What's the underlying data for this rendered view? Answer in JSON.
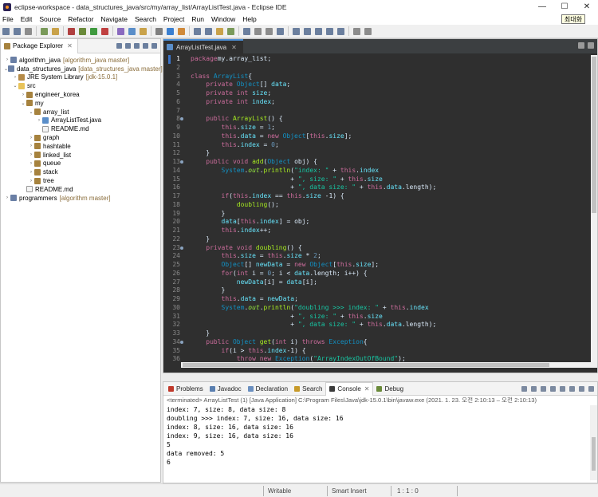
{
  "window": {
    "title": "eclipse-workspace - data_structures_java/src/my/array_list/ArrayListTest.java - Eclipse IDE",
    "minimize": "—",
    "maximize": "☐",
    "close": "✕",
    "tooltip": "최대화"
  },
  "menu": [
    "File",
    "Edit",
    "Source",
    "Refactor",
    "Navigate",
    "Search",
    "Project",
    "Run",
    "Window",
    "Help"
  ],
  "package_explorer": {
    "title": "Package Explorer",
    "items": [
      {
        "indent": 0,
        "twisty": "›",
        "icon": "proj",
        "label": "algorithm_java",
        "deco": "[algorithm_java master]"
      },
      {
        "indent": 0,
        "twisty": "⌄",
        "icon": "proj",
        "label": "data_structures_java",
        "deco": "[data_structures_java master]"
      },
      {
        "indent": 1,
        "twisty": "›",
        "icon": "lib",
        "label": "JRE System Library",
        "deco": "[jdk-15.0.1]"
      },
      {
        "indent": 1,
        "twisty": "⌄",
        "icon": "fold",
        "label": "src",
        "deco": ""
      },
      {
        "indent": 2,
        "twisty": "›",
        "icon": "pkg",
        "label": "engineer_korea",
        "deco": ""
      },
      {
        "indent": 2,
        "twisty": "⌄",
        "icon": "pkg",
        "label": "my",
        "deco": ""
      },
      {
        "indent": 3,
        "twisty": "⌄",
        "icon": "pkg",
        "label": "array_list",
        "deco": ""
      },
      {
        "indent": 4,
        "twisty": "›",
        "icon": "jfile",
        "label": "ArrayListTest.java",
        "deco": ""
      },
      {
        "indent": 4,
        "twisty": "",
        "icon": "file",
        "label": "README.md",
        "deco": ""
      },
      {
        "indent": 3,
        "twisty": "›",
        "icon": "pkg",
        "label": "graph",
        "deco": ""
      },
      {
        "indent": 3,
        "twisty": "›",
        "icon": "pkg",
        "label": "hashtable",
        "deco": ""
      },
      {
        "indent": 3,
        "twisty": "›",
        "icon": "pkg",
        "label": "linked_list",
        "deco": ""
      },
      {
        "indent": 3,
        "twisty": "›",
        "icon": "pkg",
        "label": "queue",
        "deco": ""
      },
      {
        "indent": 3,
        "twisty": "›",
        "icon": "pkg",
        "label": "stack",
        "deco": ""
      },
      {
        "indent": 3,
        "twisty": "›",
        "icon": "pkg",
        "label": "tree",
        "deco": ""
      },
      {
        "indent": 2,
        "twisty": "",
        "icon": "file",
        "label": "README.md",
        "deco": ""
      },
      {
        "indent": 0,
        "twisty": "›",
        "icon": "proj",
        "label": "programmers",
        "deco": "[algorithm master]"
      }
    ]
  },
  "editor": {
    "tab_label": "ArrayListTest.java",
    "tab_close": "✕",
    "lines": [
      {
        "n": "1",
        "mark": false,
        "cur": true,
        "t": [
          [
            "kw",
            "package"
          ],
          [
            "",
            "my.array_list;"
          ]
        ]
      },
      {
        "n": "2",
        "mark": false,
        "t": []
      },
      {
        "n": "3",
        "mark": false,
        "t": [
          [
            "kw",
            "class "
          ],
          [
            "cls",
            "ArrayList"
          ],
          [
            "",
            "{"
          ]
        ]
      },
      {
        "n": "4",
        "mark": false,
        "t": [
          [
            "",
            "    "
          ],
          [
            "kw",
            "private "
          ],
          [
            "ty",
            "Object"
          ],
          [
            "",
            "[] "
          ],
          [
            "fld",
            "data"
          ],
          [
            "",
            ";"
          ]
        ]
      },
      {
        "n": "5",
        "mark": false,
        "t": [
          [
            "",
            "    "
          ],
          [
            "kw",
            "private int "
          ],
          [
            "fld",
            "size"
          ],
          [
            "",
            ";"
          ]
        ]
      },
      {
        "n": "6",
        "mark": false,
        "t": [
          [
            "",
            "    "
          ],
          [
            "kw",
            "private int "
          ],
          [
            "fld",
            "index"
          ],
          [
            "",
            ";"
          ]
        ]
      },
      {
        "n": "7",
        "mark": false,
        "t": []
      },
      {
        "n": "8",
        "mark": true,
        "t": [
          [
            "",
            "    "
          ],
          [
            "kw",
            "public "
          ],
          [
            "mth",
            "ArrayList"
          ],
          [
            "",
            "() {"
          ]
        ]
      },
      {
        "n": "9",
        "mark": false,
        "t": [
          [
            "",
            "        "
          ],
          [
            "kw",
            "this"
          ],
          [
            "",
            "."
          ],
          [
            "fld",
            "size"
          ],
          [
            "",
            " = "
          ],
          [
            "num",
            "1"
          ],
          [
            "",
            ";"
          ]
        ]
      },
      {
        "n": "10",
        "mark": false,
        "t": [
          [
            "",
            "        "
          ],
          [
            "kw",
            "this"
          ],
          [
            "",
            "."
          ],
          [
            "fld",
            "data"
          ],
          [
            "",
            " = "
          ],
          [
            "kw",
            "new "
          ],
          [
            "ty",
            "Object"
          ],
          [
            "",
            "["
          ],
          [
            "kw",
            "this"
          ],
          [
            "",
            "."
          ],
          [
            "fld",
            "size"
          ],
          [
            "",
            "];"
          ]
        ]
      },
      {
        "n": "11",
        "mark": false,
        "t": [
          [
            "",
            "        "
          ],
          [
            "kw",
            "this"
          ],
          [
            "",
            "."
          ],
          [
            "fld",
            "index"
          ],
          [
            "",
            " = "
          ],
          [
            "num",
            "0"
          ],
          [
            "",
            ";"
          ]
        ]
      },
      {
        "n": "12",
        "mark": false,
        "t": [
          [
            "",
            "    }"
          ]
        ]
      },
      {
        "n": "13",
        "mark": true,
        "t": [
          [
            "",
            "    "
          ],
          [
            "kw",
            "public void "
          ],
          [
            "mth",
            "add"
          ],
          [
            "",
            "("
          ],
          [
            "ty",
            "Object"
          ],
          [
            "",
            " obj) {"
          ]
        ]
      },
      {
        "n": "14",
        "mark": false,
        "t": [
          [
            "",
            "        "
          ],
          [
            "ty",
            "System"
          ],
          [
            "",
            "."
          ],
          [
            "st",
            "out"
          ],
          [
            "",
            "."
          ],
          [
            "mth",
            "println"
          ],
          [
            "",
            "("
          ],
          [
            "str",
            "\"index: \""
          ],
          [
            "",
            " + "
          ],
          [
            "kw",
            "this"
          ],
          [
            "",
            "."
          ],
          [
            "fld",
            "index"
          ]
        ]
      },
      {
        "n": "15",
        "mark": false,
        "t": [
          [
            "",
            "                          + "
          ],
          [
            "str",
            "\", size: \""
          ],
          [
            "",
            " + "
          ],
          [
            "kw",
            "this"
          ],
          [
            "",
            "."
          ],
          [
            "fld",
            "size"
          ]
        ]
      },
      {
        "n": "16",
        "mark": false,
        "t": [
          [
            "",
            "                          + "
          ],
          [
            "str",
            "\", data size: \""
          ],
          [
            "",
            " + "
          ],
          [
            "kw",
            "this"
          ],
          [
            "",
            "."
          ],
          [
            "fld",
            "data"
          ],
          [
            "",
            ".length);"
          ]
        ]
      },
      {
        "n": "17",
        "mark": false,
        "t": [
          [
            "",
            "        "
          ],
          [
            "kw",
            "if"
          ],
          [
            "",
            "("
          ],
          [
            "kw",
            "this"
          ],
          [
            "",
            "."
          ],
          [
            "fld",
            "index"
          ],
          [
            "",
            " == "
          ],
          [
            "kw",
            "this"
          ],
          [
            "",
            "."
          ],
          [
            "fld",
            "size"
          ],
          [
            "",
            " -1) {"
          ]
        ]
      },
      {
        "n": "18",
        "mark": false,
        "t": [
          [
            "",
            "            "
          ],
          [
            "mth",
            "doubling"
          ],
          [
            "",
            "();"
          ]
        ]
      },
      {
        "n": "19",
        "mark": false,
        "t": [
          [
            "",
            "        }"
          ]
        ]
      },
      {
        "n": "20",
        "mark": false,
        "t": [
          [
            "",
            "        "
          ],
          [
            "fld",
            "data"
          ],
          [
            "",
            "["
          ],
          [
            "kw",
            "this"
          ],
          [
            "",
            "."
          ],
          [
            "fld",
            "index"
          ],
          [
            "",
            "] = obj;"
          ]
        ]
      },
      {
        "n": "21",
        "mark": false,
        "t": [
          [
            "",
            "        "
          ],
          [
            "kw",
            "this"
          ],
          [
            "",
            "."
          ],
          [
            "fld",
            "index"
          ],
          [
            "",
            "++;"
          ]
        ]
      },
      {
        "n": "22",
        "mark": false,
        "t": [
          [
            "",
            "    }"
          ]
        ]
      },
      {
        "n": "23",
        "mark": true,
        "t": [
          [
            "",
            "    "
          ],
          [
            "kw",
            "private void "
          ],
          [
            "mth",
            "doubling"
          ],
          [
            "",
            "() {"
          ]
        ]
      },
      {
        "n": "24",
        "mark": false,
        "t": [
          [
            "",
            "        "
          ],
          [
            "kw",
            "this"
          ],
          [
            "",
            "."
          ],
          [
            "fld",
            "size"
          ],
          [
            "",
            " = "
          ],
          [
            "kw",
            "this"
          ],
          [
            "",
            "."
          ],
          [
            "fld",
            "size"
          ],
          [
            "",
            " * "
          ],
          [
            "num",
            "2"
          ],
          [
            "",
            ";"
          ]
        ]
      },
      {
        "n": "25",
        "mark": false,
        "t": [
          [
            "",
            "        "
          ],
          [
            "ty",
            "Object"
          ],
          [
            "",
            "[] "
          ],
          [
            "fld",
            "newData"
          ],
          [
            "",
            " = "
          ],
          [
            "kw",
            "new "
          ],
          [
            "ty",
            "Object"
          ],
          [
            "",
            "["
          ],
          [
            "kw",
            "this"
          ],
          [
            "",
            "."
          ],
          [
            "fld",
            "size"
          ],
          [
            "",
            "];"
          ]
        ]
      },
      {
        "n": "26",
        "mark": false,
        "t": [
          [
            "",
            "        "
          ],
          [
            "kw",
            "for"
          ],
          [
            "",
            "("
          ],
          [
            "kw",
            "int "
          ],
          [
            "",
            "i = "
          ],
          [
            "num",
            "0"
          ],
          [
            "",
            "; i < "
          ],
          [
            "fld",
            "data"
          ],
          [
            "",
            ".length; i++) {"
          ]
        ]
      },
      {
        "n": "27",
        "mark": false,
        "t": [
          [
            "",
            "            "
          ],
          [
            "fld",
            "newData"
          ],
          [
            "",
            "[i] = "
          ],
          [
            "fld",
            "data"
          ],
          [
            "",
            "[i];"
          ]
        ]
      },
      {
        "n": "28",
        "mark": false,
        "t": [
          [
            "",
            "        }"
          ]
        ]
      },
      {
        "n": "29",
        "mark": false,
        "t": [
          [
            "",
            "        "
          ],
          [
            "kw",
            "this"
          ],
          [
            "",
            "."
          ],
          [
            "fld",
            "data"
          ],
          [
            "",
            " = "
          ],
          [
            "fld",
            "newData"
          ],
          [
            "",
            ";"
          ]
        ]
      },
      {
        "n": "30",
        "mark": false,
        "t": [
          [
            "",
            "        "
          ],
          [
            "ty",
            "System"
          ],
          [
            "",
            "."
          ],
          [
            "st",
            "out"
          ],
          [
            "",
            "."
          ],
          [
            "mth",
            "println"
          ],
          [
            "",
            "("
          ],
          [
            "str",
            "\"doubling >>> index: \""
          ],
          [
            "",
            " + "
          ],
          [
            "kw",
            "this"
          ],
          [
            "",
            "."
          ],
          [
            "fld",
            "index"
          ]
        ]
      },
      {
        "n": "31",
        "mark": false,
        "t": [
          [
            "",
            "                          + "
          ],
          [
            "str",
            "\", size: \""
          ],
          [
            "",
            " + "
          ],
          [
            "kw",
            "this"
          ],
          [
            "",
            "."
          ],
          [
            "fld",
            "size"
          ]
        ]
      },
      {
        "n": "32",
        "mark": false,
        "t": [
          [
            "",
            "                          + "
          ],
          [
            "str",
            "\", data size: \""
          ],
          [
            "",
            " + "
          ],
          [
            "kw",
            "this"
          ],
          [
            "",
            "."
          ],
          [
            "fld",
            "data"
          ],
          [
            "",
            ".length);"
          ]
        ]
      },
      {
        "n": "33",
        "mark": false,
        "t": [
          [
            "",
            "    }"
          ]
        ]
      },
      {
        "n": "34",
        "mark": true,
        "t": [
          [
            "",
            "    "
          ],
          [
            "kw",
            "public "
          ],
          [
            "ty",
            "Object "
          ],
          [
            "mth",
            "get"
          ],
          [
            "",
            "("
          ],
          [
            "kw",
            "int "
          ],
          [
            "",
            "i) "
          ],
          [
            "kw",
            "throws "
          ],
          [
            "ty",
            "Exception"
          ],
          [
            "",
            "{"
          ]
        ]
      },
      {
        "n": "35",
        "mark": false,
        "t": [
          [
            "",
            "        "
          ],
          [
            "kw",
            "if"
          ],
          [
            "",
            "(i > "
          ],
          [
            "kw",
            "this"
          ],
          [
            "",
            "."
          ],
          [
            "fld",
            "index"
          ],
          [
            "",
            "-1) {"
          ]
        ]
      },
      {
        "n": "36",
        "mark": false,
        "t": [
          [
            "",
            "            "
          ],
          [
            "kw",
            "throw new "
          ],
          [
            "ty",
            "Exception"
          ],
          [
            "",
            "("
          ],
          [
            "str",
            "\"ArrayIndexOutOfBound\""
          ],
          [
            "",
            ");"
          ]
        ]
      }
    ]
  },
  "console": {
    "tabs": [
      {
        "label": "Problems",
        "color": "#c0392b",
        "active": false
      },
      {
        "label": "Javadoc",
        "color": "#5a7fb0",
        "active": false
      },
      {
        "label": "Declaration",
        "color": "#6a8fc0",
        "active": false
      },
      {
        "label": "Search",
        "color": "#c79a2a",
        "active": false
      },
      {
        "label": "Console",
        "color": "#3a3a3a",
        "active": true
      },
      {
        "label": "Debug",
        "color": "#6a8a3a",
        "active": false
      }
    ],
    "info": "<terminated> ArrayListTest (1) [Java Application] C:\\Program Files\\Java\\jdk-15.0.1\\bin\\javaw.exe  (2021. 1. 23. 오전 2:10:13 – 오전 2:10:13)",
    "output": [
      "index: 7, size: 8, data size: 8",
      "doubling >>> index: 7, size: 16, data size: 16",
      "index: 8, size: 16, data size: 16",
      "index: 9, size: 16, data size: 16",
      "5",
      "data removed: 5",
      "6"
    ]
  },
  "status": {
    "writable": "Writable",
    "insert": "Smart Insert",
    "position": "1 : 1 : 0"
  }
}
